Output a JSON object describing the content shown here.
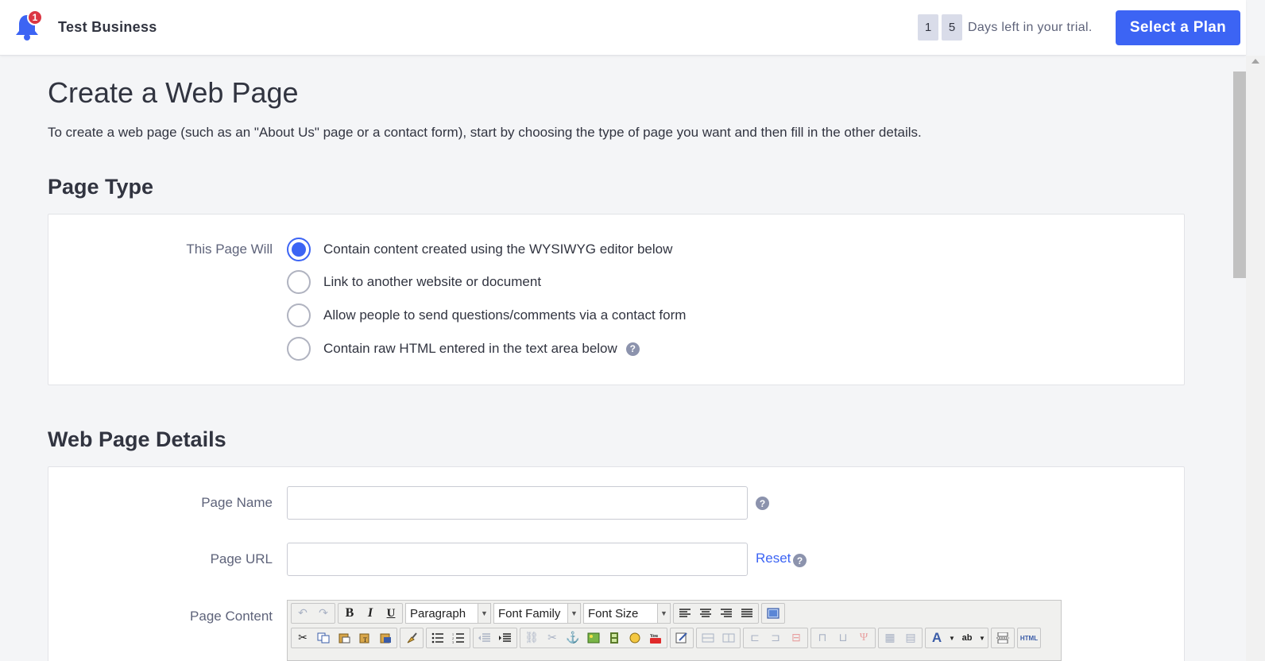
{
  "topbar": {
    "notification_count": "1",
    "store_name": "Test Business",
    "trial_digits": [
      "1",
      "5"
    ],
    "trial_text": "Days left in your trial.",
    "plan_button": "Select a Plan"
  },
  "page": {
    "title": "Create a Web Page",
    "description": "To create a web page (such as an \"About Us\" page or a contact form), start by choosing the type of page you want and then fill in the other details."
  },
  "page_type": {
    "heading": "Page Type",
    "label": "This Page Will",
    "options": [
      {
        "label": "Contain content created using the WYSIWYG editor below",
        "checked": true
      },
      {
        "label": "Link to another website or document",
        "checked": false
      },
      {
        "label": "Allow people to send questions/comments via a contact form",
        "checked": false
      },
      {
        "label": "Contain raw HTML entered in the text area below",
        "checked": false
      }
    ],
    "help_glyph": "?"
  },
  "details": {
    "heading": "Web Page Details",
    "page_name_label": "Page Name",
    "page_name_value": "",
    "page_url_label": "Page URL",
    "page_url_value": "",
    "reset_link": "Reset",
    "page_content_label": "Page Content",
    "help_glyph": "?"
  },
  "editor": {
    "format_select": "Paragraph",
    "font_family_select": "Font Family",
    "font_size_select": "Font Size",
    "bold": "B",
    "italic": "I",
    "underline": "U",
    "html_button": "HTML"
  },
  "colors": {
    "accent": "#3c64f4",
    "badge": "#db3643"
  }
}
